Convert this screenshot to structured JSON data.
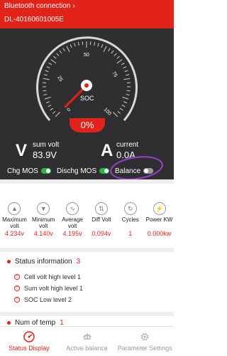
{
  "header": {
    "connection_label": "Bluetooth connection",
    "device_id": "DL-40160601005E"
  },
  "gauge": {
    "ticks": [
      "0",
      "25",
      "50",
      "75",
      "100"
    ],
    "center_label": "SOC",
    "soc_value": "0%",
    "soc_fraction": 0.0
  },
  "metrics": {
    "sum_volt": {
      "label": "sum volt",
      "value": "83.9V",
      "icon_text": "V"
    },
    "current": {
      "label": "current",
      "value": "0.0A",
      "icon_text": "A"
    }
  },
  "toggles": [
    {
      "label": "Chg MOS",
      "state": "on"
    },
    {
      "label": "Dischg MOS",
      "state": "on"
    },
    {
      "label": "Balance",
      "state": "off"
    }
  ],
  "stats": [
    {
      "name": "Maximum volt",
      "value": "4.234v",
      "icon": "max-volt-icon"
    },
    {
      "name": "Minimum volt",
      "value": "4.140v",
      "icon": "min-volt-icon"
    },
    {
      "name": "Average volt",
      "value": "4.195v",
      "icon": "wave-icon"
    },
    {
      "name": "Diff Volt",
      "value": "0.094v",
      "icon": "diff-icon"
    },
    {
      "name": "Cycles",
      "value": "1",
      "icon": "cycle-icon"
    },
    {
      "name": "Power KW",
      "value": "0.000kw",
      "icon": "power-icon"
    }
  ],
  "status": {
    "title": "Status information",
    "count": "3",
    "alerts": [
      "Cell volt high level 1",
      "Sum volt high level 1",
      "SOC Low level 2"
    ]
  },
  "temp": {
    "title": "Num of temp",
    "count": "1"
  },
  "nav": [
    {
      "label": "Status Display",
      "active": true,
      "icon": "status-display-icon"
    },
    {
      "label": "Active balance",
      "active": false,
      "icon": "active-balance-icon"
    },
    {
      "label": "Parameter Settings",
      "active": false,
      "icon": "settings-icon"
    }
  ],
  "colors": {
    "brand_red": "#e2231a",
    "dashboard_bg": "#2f2f31",
    "toggle_on": "#2bb24c",
    "annotation": "#9b3fd8"
  }
}
